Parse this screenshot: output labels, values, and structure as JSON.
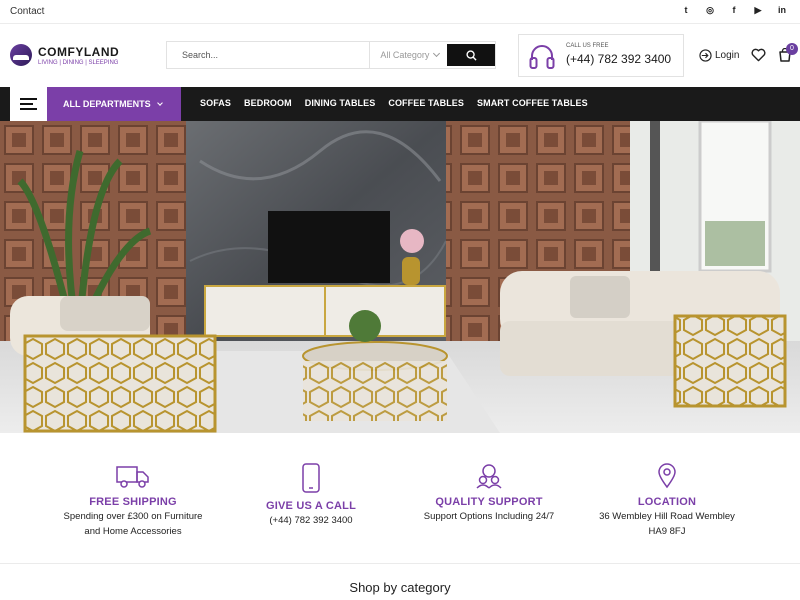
{
  "topbar": {
    "contact": "Contact",
    "social": [
      {
        "icon": "twitter-icon",
        "glyph": "t"
      },
      {
        "icon": "instagram-icon",
        "glyph": "◎"
      },
      {
        "icon": "facebook-icon",
        "glyph": "f"
      },
      {
        "icon": "youtube-icon",
        "glyph": "▶"
      },
      {
        "icon": "linkedin-icon",
        "glyph": "in"
      }
    ]
  },
  "header": {
    "logo_title": "COMFYLAND",
    "logo_tagline": "LIVING | DINING | SLEEPING",
    "search_placeholder": "Search...",
    "category_label": "All Category",
    "call_label": "CALL US FREE",
    "call_number": "(+44) 782 392 3400",
    "login_label": "Login",
    "cart_count": "0"
  },
  "nav": {
    "departments_label": "ALL DEPARTMENTS",
    "items": [
      "SOFAS",
      "BEDROOM",
      "DINING TABLES",
      "COFFEE TABLES",
      "SMART COFFEE TABLES"
    ]
  },
  "features": [
    {
      "icon": "truck-icon",
      "title": "FREE SHIPPING",
      "lines": [
        "Spending over £300 on Furniture",
        "and Home Accessories"
      ]
    },
    {
      "icon": "phone-icon",
      "title": "GIVE US A CALL",
      "lines": [
        "(+44) 782 392 3400"
      ]
    },
    {
      "icon": "support-icon",
      "title": "QUALITY SUPPORT",
      "lines": [
        "Support Options Including 24/7"
      ]
    },
    {
      "icon": "location-pin-icon",
      "title": "LOCATION",
      "lines": [
        "36 Wembley Hill Road Wembley",
        "HA9 8FJ"
      ]
    }
  ],
  "section_title": "Shop by category",
  "colors": {
    "accent": "#7b3fa8",
    "nav_bg": "#1a1a1a"
  }
}
